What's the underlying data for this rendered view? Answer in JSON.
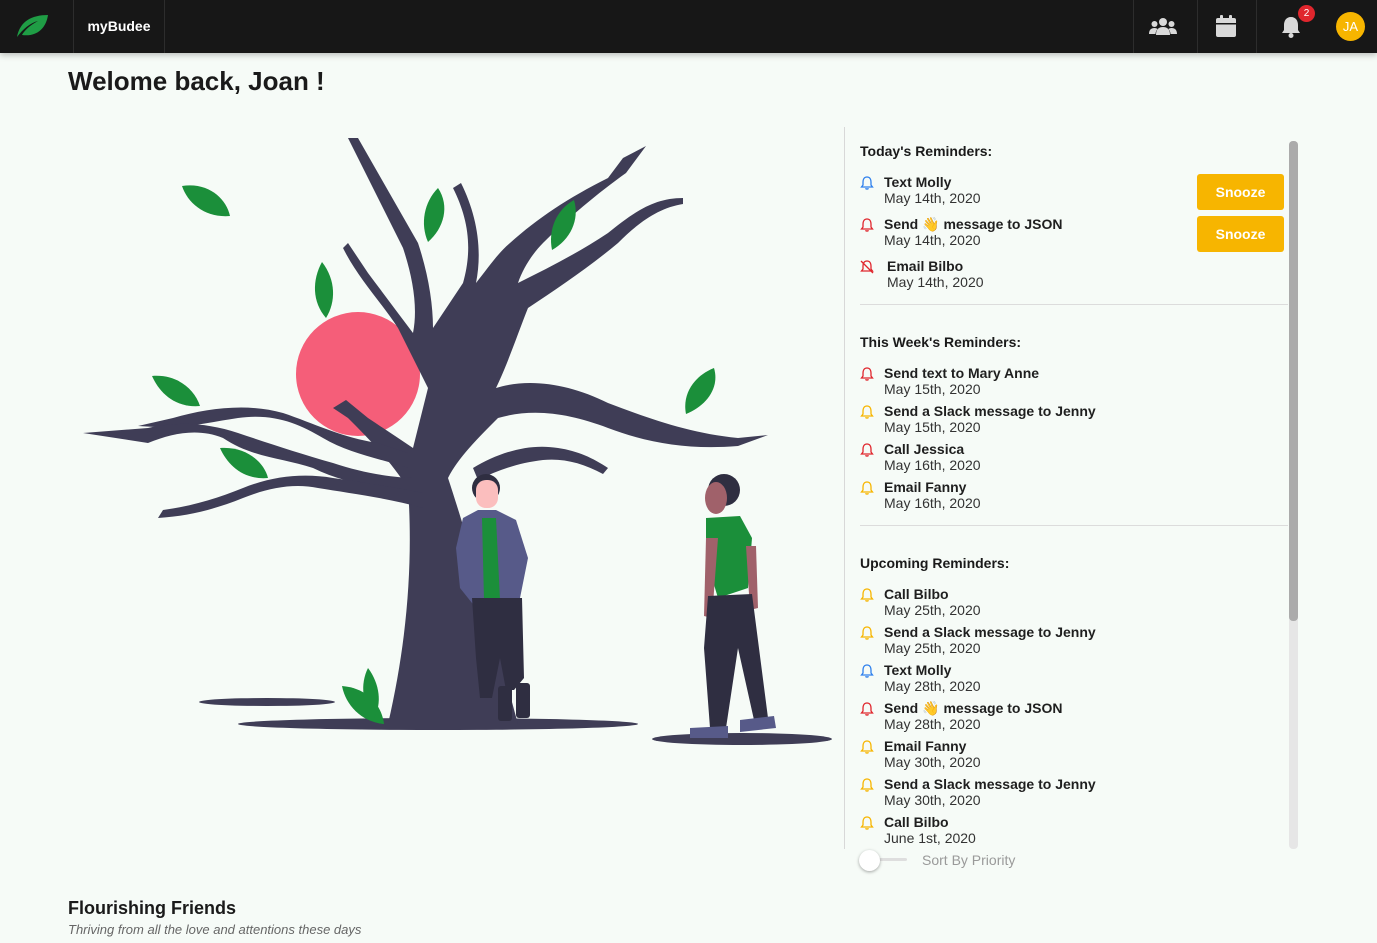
{
  "header": {
    "app_name": "myBudee",
    "notification_count": "2",
    "avatar_initials": "JA",
    "icons": [
      "leaf-logo-icon",
      "users-icon",
      "calendar-icon",
      "bell-icon"
    ]
  },
  "welcome": "Welome back, Joan !",
  "reminders": {
    "today_title": "Today's Reminders:",
    "today": [
      {
        "title": "Text Molly",
        "date": "May 14th, 2020",
        "bell": "blue",
        "snooze": "Snooze"
      },
      {
        "title_pre": "Send",
        "emoji": "👋",
        "title_post": "message to JSON",
        "date": "May 14th, 2020",
        "bell": "red",
        "snooze": "Snooze"
      },
      {
        "title": "Email Bilbo",
        "date": "May 14th, 2020",
        "bell": "red-muted"
      }
    ],
    "week_title": "This Week's Reminders:",
    "week": [
      {
        "title": "Send text to Mary Anne",
        "date": "May 15th, 2020",
        "bell": "red"
      },
      {
        "title": "Send a Slack message to Jenny",
        "date": "May 15th, 2020",
        "bell": "yellow"
      },
      {
        "title": "Call Jessica",
        "date": "May 16th, 2020",
        "bell": "red"
      },
      {
        "title": "Email Fanny",
        "date": "May 16th, 2020",
        "bell": "yellow"
      }
    ],
    "upcoming_title": "Upcoming Reminders:",
    "upcoming": [
      {
        "title": "Call Bilbo",
        "date": "May 25th, 2020",
        "bell": "yellow"
      },
      {
        "title": "Send a Slack message to Jenny",
        "date": "May 25th, 2020",
        "bell": "yellow"
      },
      {
        "title": "Text Molly",
        "date": "May 28th, 2020",
        "bell": "blue"
      },
      {
        "title_pre": "Send",
        "emoji": "👋",
        "title_post": "message to JSON",
        "date": "May 28th, 2020",
        "bell": "red"
      },
      {
        "title": "Email Fanny",
        "date": "May 30th, 2020",
        "bell": "yellow"
      },
      {
        "title": "Send a Slack message to Jenny",
        "date": "May 30th, 2020",
        "bell": "yellow"
      },
      {
        "title": "Call Bilbo",
        "date": "June 1st, 2020",
        "bell": "yellow"
      }
    ],
    "sort_label": "Sort By Priority",
    "sort_enabled": false
  },
  "friends": {
    "title": "Flourishing Friends",
    "subtitle": "Thriving from all the love and attentions these days"
  },
  "colors": {
    "topbar": "#171717",
    "accent": "#f7b500",
    "leaf_green": "#1b8f3a",
    "tree": "#3f3d56",
    "sun": "#f55e79",
    "bell_blue": "#2f80ed",
    "bell_red": "#e0262d",
    "bell_yellow": "#f7b500"
  }
}
